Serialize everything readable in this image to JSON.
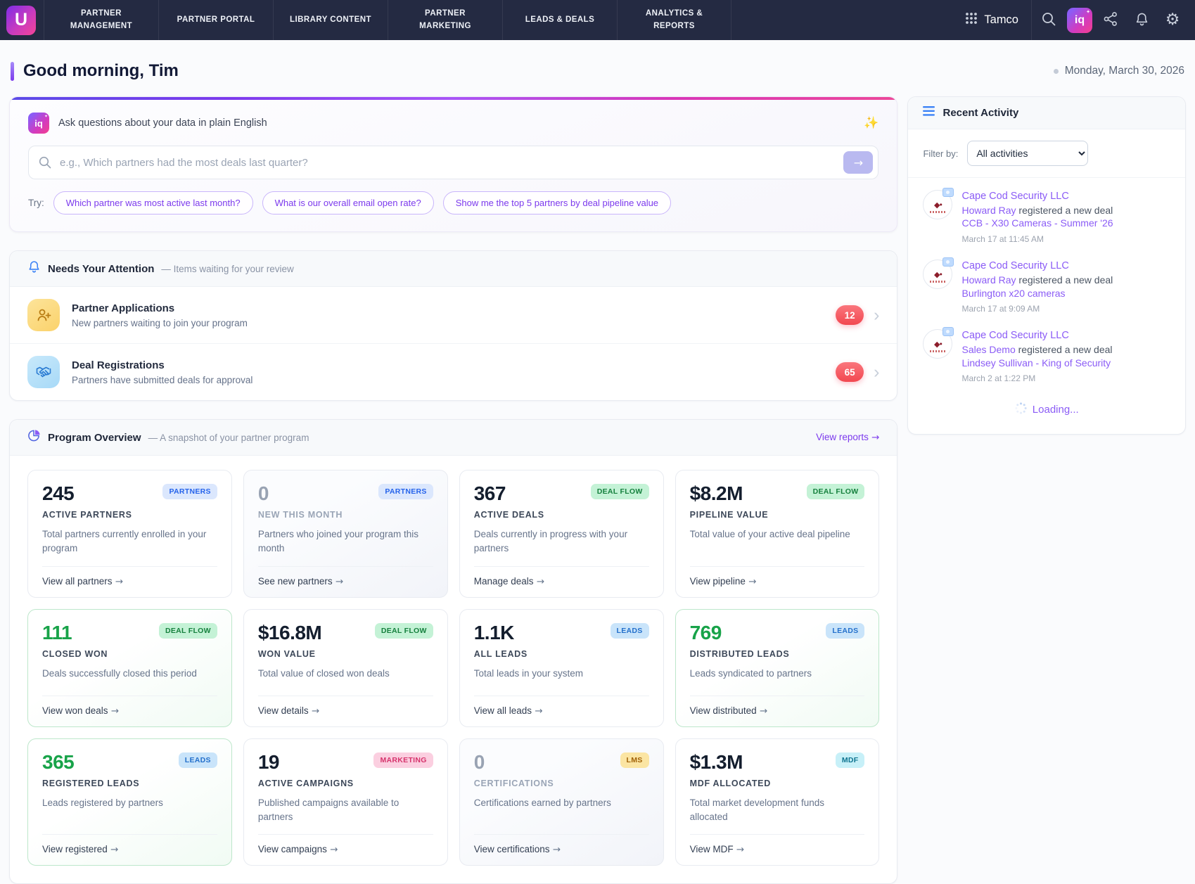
{
  "nav": {
    "brand_letter": "U",
    "items": [
      "PARTNER MANAGEMENT",
      "PARTNER PORTAL",
      "LIBRARY CONTENT",
      "PARTNER MARKETING",
      "LEADS & DEALS",
      "ANALYTICS & REPORTS"
    ],
    "workspace": "Tamco",
    "iq_label": "iq"
  },
  "header": {
    "greeting": "Good morning, Tim",
    "date": "Monday, March 30, 2026"
  },
  "ai": {
    "prompt_label": "Ask questions about your data in plain English",
    "input_value": "",
    "input_placeholder": "e.g., Which partners had the most deals last quarter?",
    "try_label": "Try:",
    "suggestions": [
      "Which partner was most active last month?",
      "What is our overall email open rate?",
      "Show me the top 5 partners by deal pipeline value"
    ]
  },
  "attention": {
    "title": "Needs Your Attention",
    "subtitle": "— Items waiting for your review",
    "items": [
      {
        "title": "Partner Applications",
        "description": "New partners waiting to join your program",
        "count": "12"
      },
      {
        "title": "Deal Registrations",
        "description": "Partners have submitted deals for approval",
        "count": "65"
      }
    ]
  },
  "overview": {
    "title": "Program Overview",
    "subtitle": "— A snapshot of your partner program",
    "view_reports": "View reports",
    "cards": [
      {
        "value": "245",
        "badge": "PARTNERS",
        "label": "ACTIVE PARTNERS",
        "description": "Total partners currently enrolled in your program",
        "link": "View all partners"
      },
      {
        "value": "0",
        "badge": "PARTNERS",
        "label": "NEW THIS MONTH",
        "description": "Partners who joined your program this month",
        "link": "See new partners"
      },
      {
        "value": "367",
        "badge": "DEAL FLOW",
        "label": "ACTIVE DEALS",
        "description": "Deals currently in progress with your partners",
        "link": "Manage deals"
      },
      {
        "value": "$8.2M",
        "badge": "DEAL FLOW",
        "label": "PIPELINE VALUE",
        "description": "Total value of your active deal pipeline",
        "link": "View pipeline"
      },
      {
        "value": "111",
        "badge": "DEAL FLOW",
        "label": "CLOSED WON",
        "description": "Deals successfully closed this period",
        "link": "View won deals"
      },
      {
        "value": "$16.8M",
        "badge": "DEAL FLOW",
        "label": "WON VALUE",
        "description": "Total value of closed won deals",
        "link": "View details"
      },
      {
        "value": "1.1K",
        "badge": "LEADS",
        "label": "ALL LEADS",
        "description": "Total leads in your system",
        "link": "View all leads"
      },
      {
        "value": "769",
        "badge": "LEADS",
        "label": "DISTRIBUTED LEADS",
        "description": "Leads syndicated to partners",
        "link": "View distributed"
      },
      {
        "value": "365",
        "badge": "LEADS",
        "label": "REGISTERED LEADS",
        "description": "Leads registered by partners",
        "link": "View registered"
      },
      {
        "value": "19",
        "badge": "MARKETING",
        "label": "ACTIVE CAMPAIGNS",
        "description": "Published campaigns available to partners",
        "link": "View campaigns"
      },
      {
        "value": "0",
        "badge": "LMS",
        "label": "CERTIFICATIONS",
        "description": "Certifications earned by partners",
        "link": "View certifications"
      },
      {
        "value": "$1.3M",
        "badge": "MDF",
        "label": "MDF ALLOCATED",
        "description": "Total market development funds allocated",
        "link": "View MDF"
      }
    ]
  },
  "activity": {
    "title": "Recent Activity",
    "filter_label": "Filter by:",
    "filter_value": "All activities",
    "items": [
      {
        "company": "Cape Cod Security LLC",
        "actor": "Howard Ray",
        "action": "registered a new deal",
        "deal": "CCB - X30 Cameras - Summer '26",
        "time": "March 17 at 11:45 AM"
      },
      {
        "company": "Cape Cod Security LLC",
        "actor": "Howard Ray",
        "action": "registered a new deal",
        "deal": "Burlington x20 cameras",
        "time": "March 17 at 9:09 AM"
      },
      {
        "company": "Cape Cod Security LLC",
        "actor": "Sales Demo",
        "action": "registered a new deal",
        "deal": "Lindsey Sullivan - King of Security",
        "time": "March 2 at 1:22 PM"
      }
    ],
    "loading_label": "Loading..."
  },
  "colors": {
    "nav_bg": "#242a42",
    "accent_purple": "#7c3aed",
    "positive_green": "#18a349",
    "alert_red": "#f24850",
    "badge_blue": "#2563eb"
  }
}
